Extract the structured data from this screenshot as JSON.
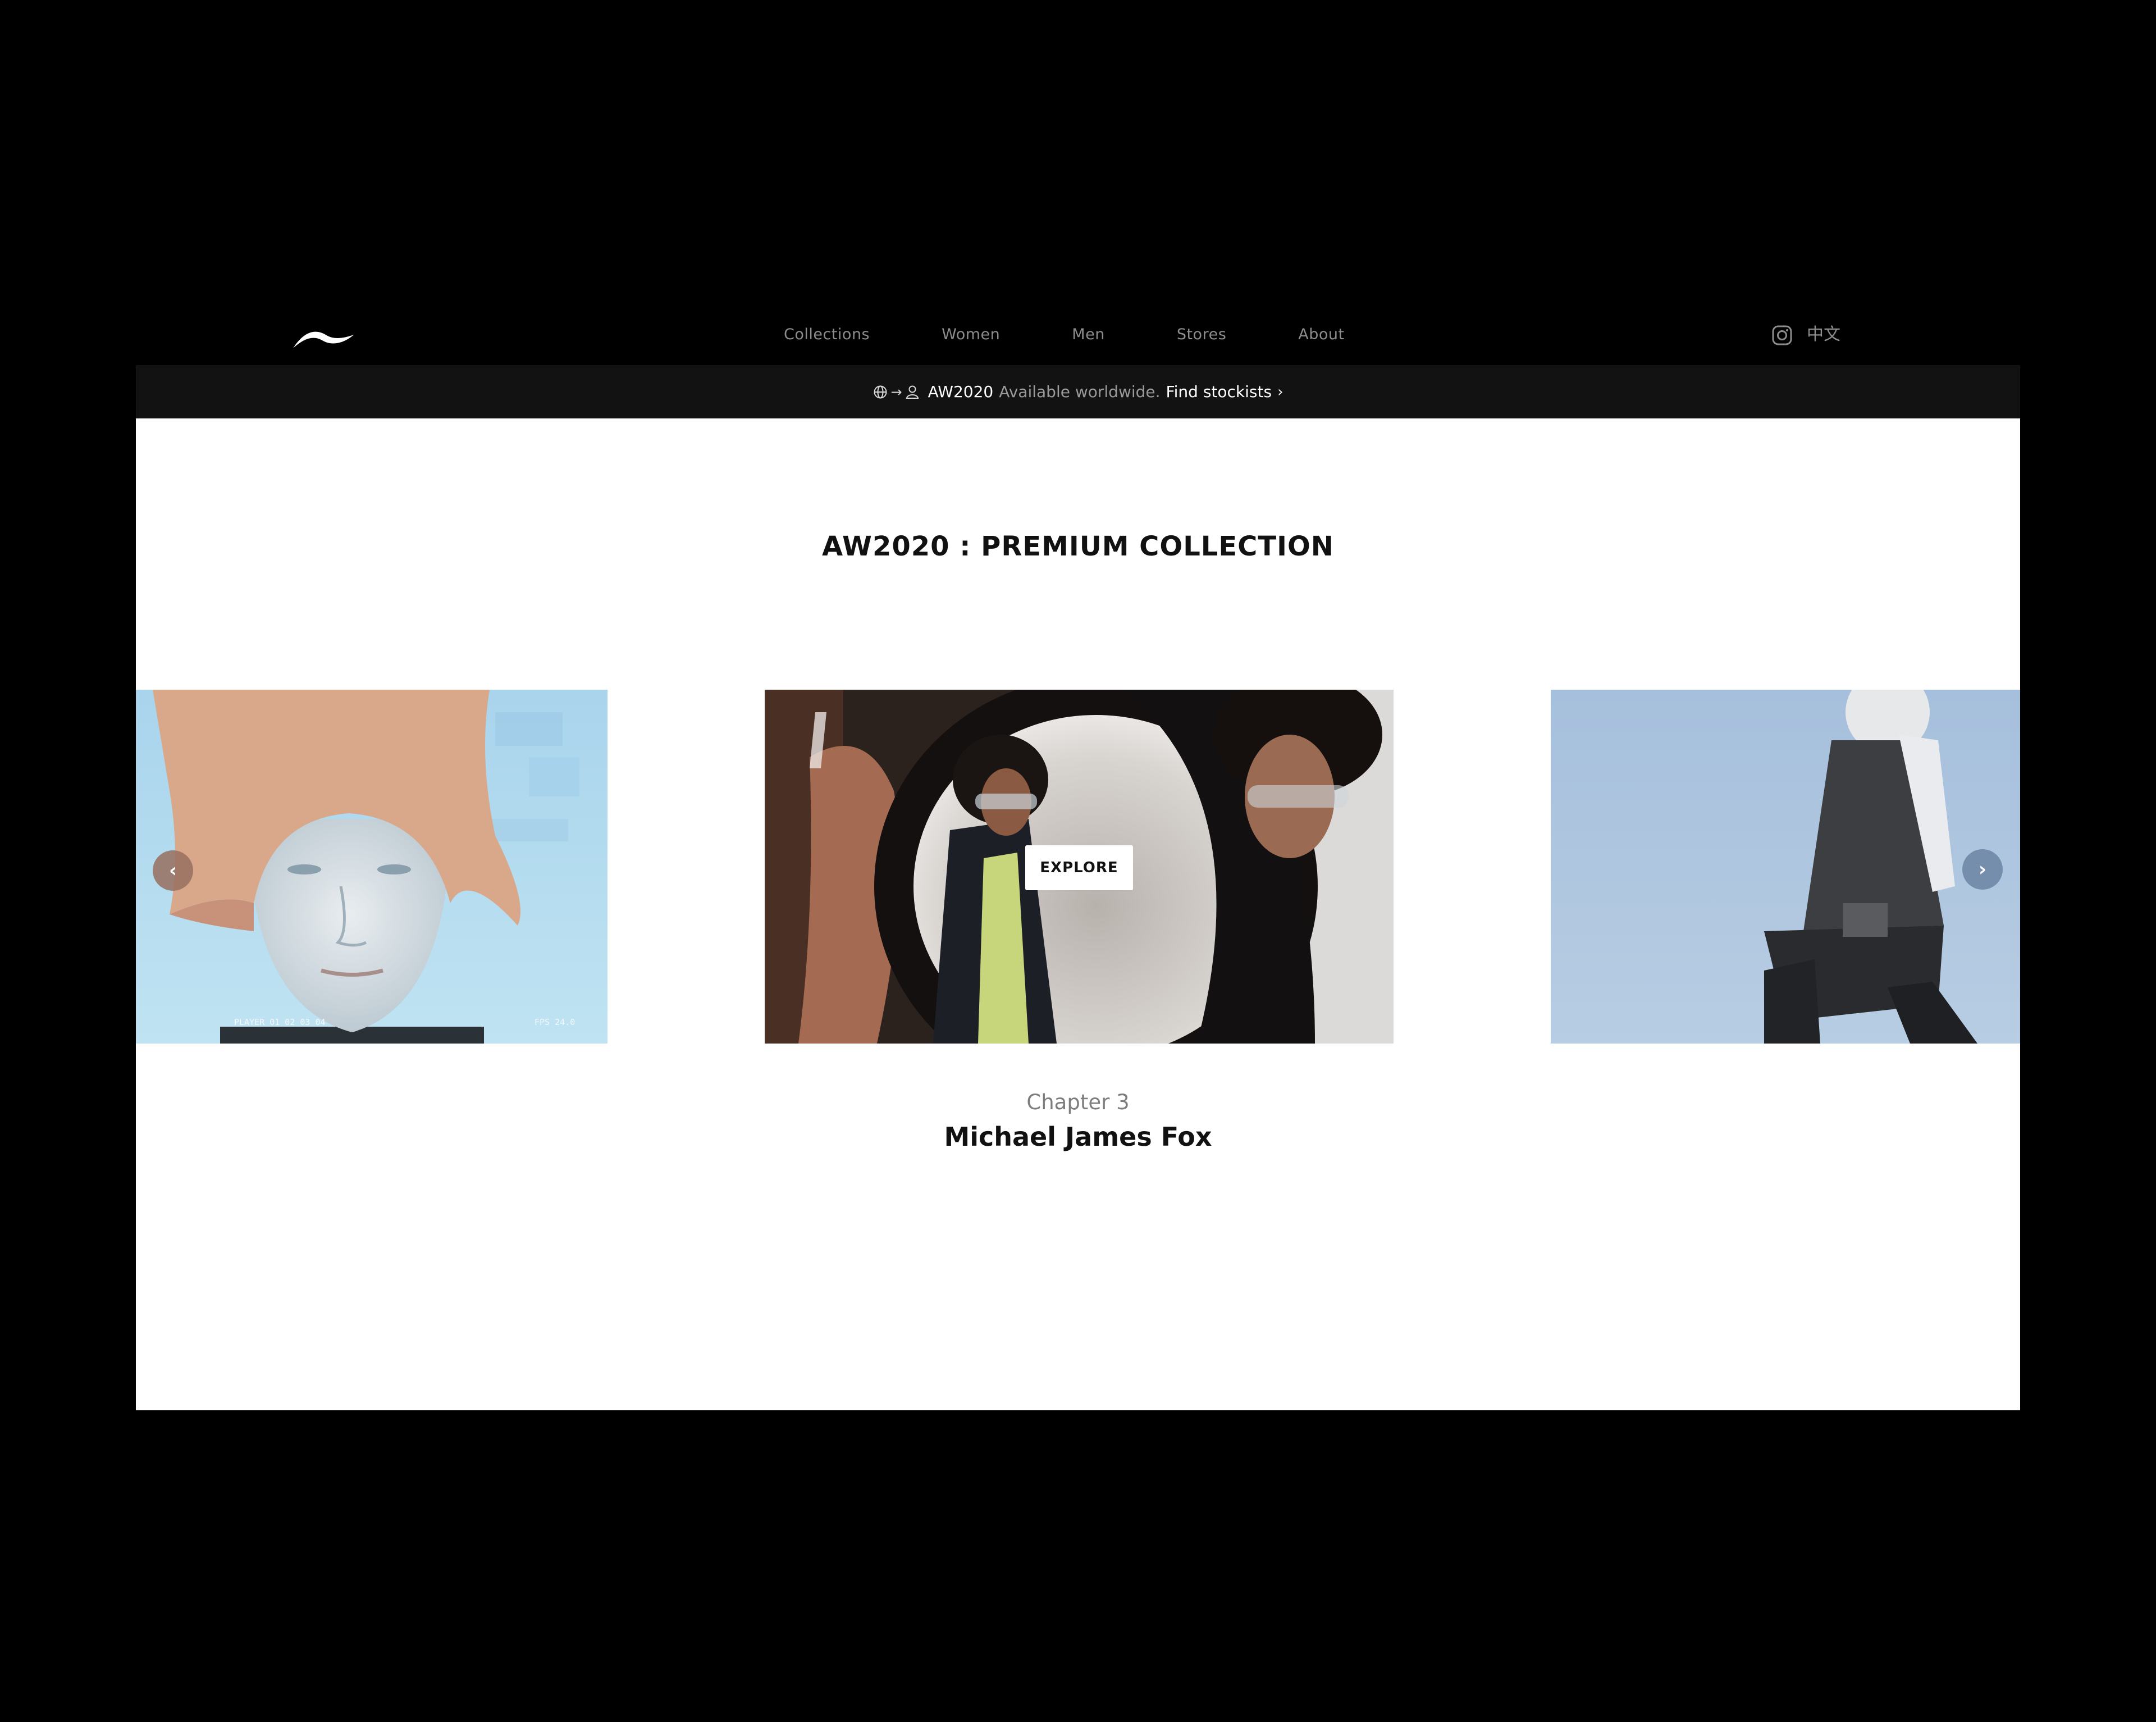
{
  "header": {
    "logo": "li-ning-logo",
    "nav": [
      "Collections",
      "Women",
      "Men",
      "Stores",
      "About"
    ],
    "instagram_icon": "instagram-icon",
    "language": "中文"
  },
  "announcement": {
    "icons": [
      "globe-icon",
      "arrow-right-icon",
      "person-icon"
    ],
    "arrow_glyph": "→",
    "season": "AW2020",
    "text": "Available worldwide.",
    "link": "Find stockists",
    "chevron": "›"
  },
  "main": {
    "title": "AW2020 : PREMIUM COLLECTION",
    "carousel": {
      "prev_glyph": "‹",
      "next_glyph": "›",
      "explore_label": "EXPLORE",
      "left_overlay": "PLAYER  01  02  03  04",
      "left_overlay_right": "FPS  24.0"
    },
    "chapter_label": "Chapter 3",
    "chapter_title": "Michael James Fox"
  },
  "colors": {
    "background": "#000000",
    "bar": "#121212",
    "nav_text": "#8c8c8c",
    "panel": "#ffffff"
  }
}
